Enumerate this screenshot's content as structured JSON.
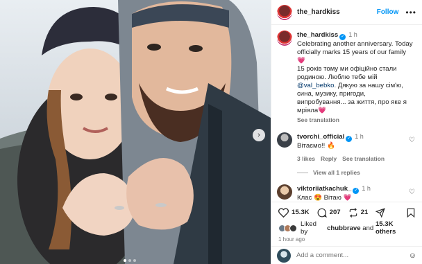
{
  "header": {
    "username": "the_hardkiss",
    "follow_label": "Follow",
    "more_icon": "more-horizontal-icon"
  },
  "caption": {
    "username": "the_hardkiss",
    "time": "1 h",
    "line1": "Celebrating another anniversary. Today officially marks 15 years of our family",
    "heart": "💗",
    "line2_a": "15 років тому ми офіційно стали родиною. Люблю тебе мій ",
    "mention": "@val_bebko",
    "line2_b": ". Дякую за нашу сім'ю, сина, музику, пригоди, випробування... за життя, про яке я мріяла",
    "heart2": "💗",
    "see_translation": "See translation"
  },
  "comments": [
    {
      "username": "tvorchi_official",
      "time": "1 h",
      "text": "Вітаємо!! 🔥",
      "likes": "3 likes",
      "reply": "Reply",
      "see_translation": "See translation",
      "view_replies": "View all 1 replies"
    },
    {
      "username": "viktoriiatkachuk_",
      "time": "1 h",
      "text": "Клас 😍 Вітаю 💗"
    }
  ],
  "actions": {
    "likes_count": "15.3K",
    "comments_count": "207",
    "reposts_count": "21"
  },
  "liked_by": {
    "prefix": "Liked by ",
    "user": "chubbrave",
    "mid": " and ",
    "others": "15.3K others"
  },
  "timestamp": "1 hour ago",
  "add_comment": {
    "placeholder": "Add a comment..."
  },
  "colors": {
    "accent": "#0095f6",
    "heart": "#e1306c"
  }
}
